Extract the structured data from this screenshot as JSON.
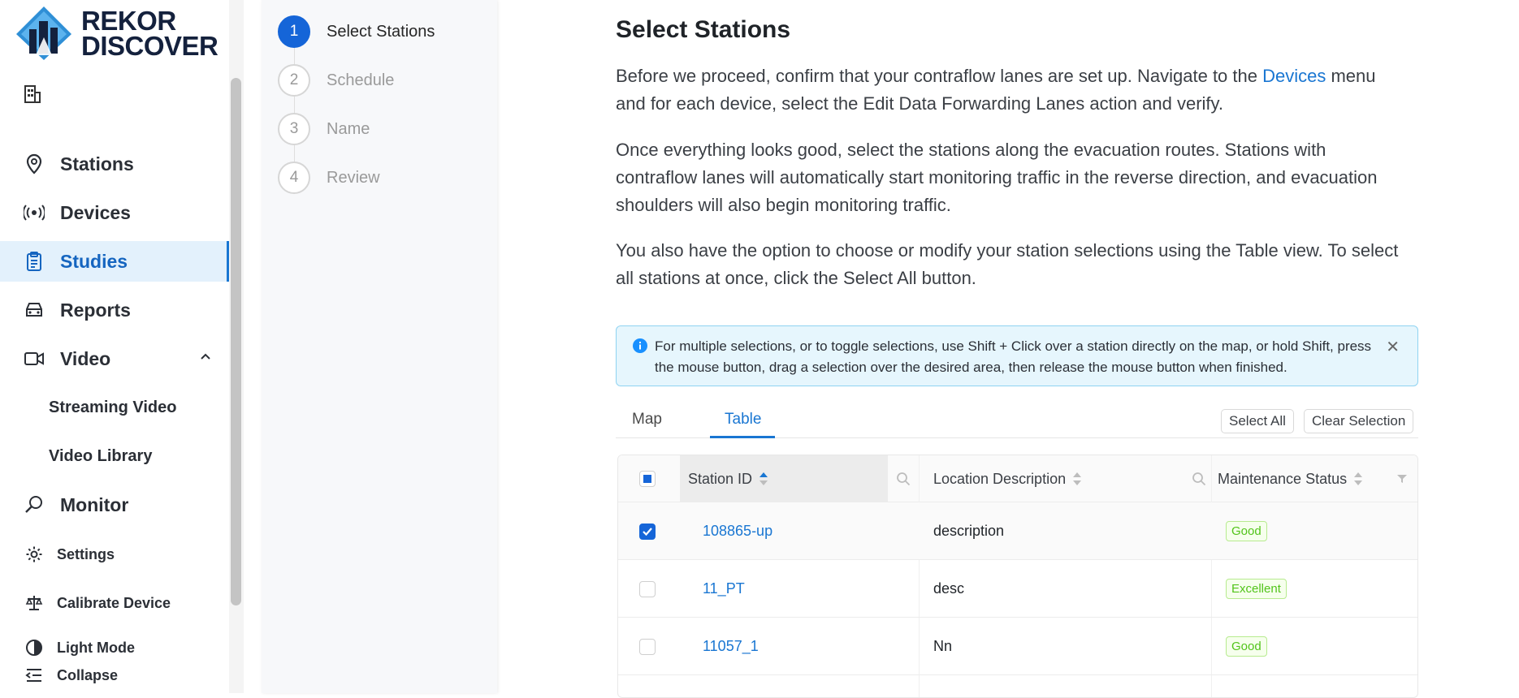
{
  "brand": {
    "line1": "REKOR",
    "line2": "DISCOVER"
  },
  "sidebar": {
    "items": [
      {
        "label": "Stations",
        "icon": "map-pin-icon"
      },
      {
        "label": "Devices",
        "icon": "broadcast-icon"
      },
      {
        "label": "Studies",
        "icon": "clipboard-icon",
        "active": true
      },
      {
        "label": "Reports",
        "icon": "car-icon"
      },
      {
        "label": "Video",
        "icon": "video-camera-icon",
        "expanded": true
      },
      {
        "label": "Streaming Video",
        "sub": true
      },
      {
        "label": "Video Library",
        "sub": true
      },
      {
        "label": "Monitor",
        "icon": "magnifier-icon"
      },
      {
        "label": "Settings",
        "icon": "gear-icon"
      },
      {
        "label": "Calibrate Device",
        "icon": "scale-icon"
      },
      {
        "label": "Light Mode",
        "icon": "contrast-icon"
      },
      {
        "label": "Collapse",
        "icon": "collapse-icon"
      }
    ]
  },
  "steps": [
    {
      "num": "1",
      "label": "Select Stations",
      "active": true
    },
    {
      "num": "2",
      "label": "Schedule"
    },
    {
      "num": "3",
      "label": "Name"
    },
    {
      "num": "4",
      "label": "Review"
    }
  ],
  "main": {
    "title": "Select Stations",
    "p1_before": "Before we proceed, confirm that your contraflow lanes are set up. Navigate to the ",
    "p1_link": "Devices",
    "p1_after": " menu and for each device, select the Edit Data Forwarding Lanes action and verify.",
    "p2": "Once everything looks good, select the stations along the evacuation routes. Stations with contraflow lanes will automatically start monitoring traffic in the reverse direction, and evacuation shoulders will also begin monitoring traffic.",
    "p3": "You also have the option to choose or modify your station selections using the Table view. To select all stations at once, click the Select All button.",
    "alert": "For multiple selections, or to toggle selections, use Shift + Click over a station directly on the map, or hold Shift, press the mouse button, drag a selection over the desired area, then release the mouse button when finished.",
    "tabs": {
      "map": "Map",
      "table": "Table"
    },
    "select_all": "Select All",
    "clear_selection": "Clear Selection"
  },
  "table": {
    "columns": {
      "station_id": "Station ID",
      "location": "Location Description",
      "status": "Maintenance Status"
    },
    "rows": [
      {
        "id": "108865-up",
        "location": "description",
        "status": "Good",
        "checked": true
      },
      {
        "id": "11_PT",
        "location": "desc",
        "status": "Excellent",
        "checked": false
      },
      {
        "id": "11057_1",
        "location": "Nn",
        "status": "Good",
        "checked": false
      }
    ]
  },
  "colors": {
    "accent": "#1976d2",
    "active_bg": "#e3f1fc",
    "badge_green": "#52c41a",
    "alert_bg": "#e6f6fd"
  }
}
